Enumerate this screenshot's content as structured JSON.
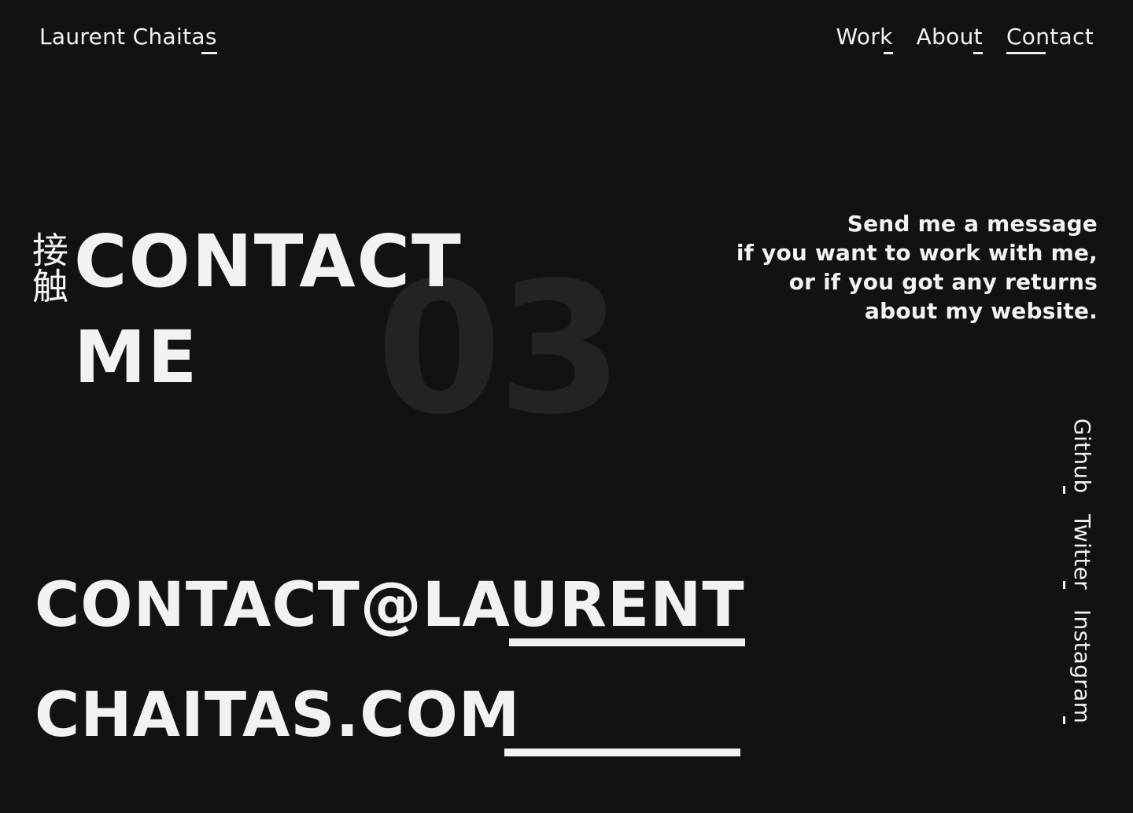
{
  "header": {
    "brand": "Laurent Chaitas",
    "nav": [
      {
        "label": "Work",
        "active": false
      },
      {
        "label": "About",
        "active": false
      },
      {
        "label": "Contact",
        "active": true
      }
    ]
  },
  "hero": {
    "cjk_label": "接触",
    "title_line1": "CONTACT",
    "title_line2": "ME",
    "ghost_number": "03"
  },
  "intro": {
    "line1": "Send me a message",
    "line2": "if you want to work with me,",
    "line3": "or if you got any returns",
    "line4": "about my website."
  },
  "email": {
    "line1": "CONTACT@LAURENT",
    "line2": "CHAITAS.COM"
  },
  "socials": [
    {
      "label": "Github"
    },
    {
      "label": "Twitter"
    },
    {
      "label": "Instagram"
    }
  ],
  "colors": {
    "background": "#121212",
    "text": "#f2f2f2",
    "ghost": "#232323"
  }
}
